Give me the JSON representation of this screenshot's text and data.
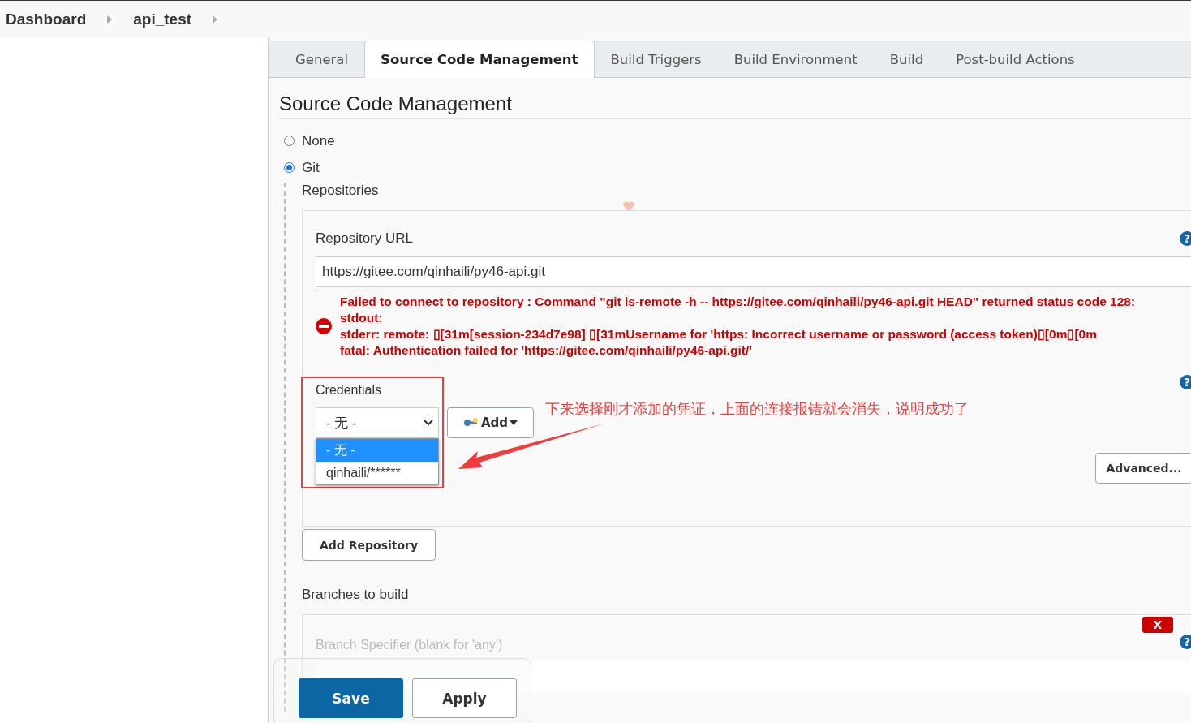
{
  "breadcrumb": [
    {
      "label": "Dashboard"
    },
    {
      "label": "api_test"
    }
  ],
  "tabs": [
    {
      "label": "General",
      "selected": false
    },
    {
      "label": "Source Code Management",
      "selected": true
    },
    {
      "label": "Build Triggers",
      "selected": false
    },
    {
      "label": "Build Environment",
      "selected": false
    },
    {
      "label": "Build",
      "selected": false
    },
    {
      "label": "Post-build Actions",
      "selected": false
    }
  ],
  "section_title": "Source Code Management",
  "scm_options": [
    {
      "label": "None",
      "selected": false
    },
    {
      "label": "Git",
      "selected": true
    }
  ],
  "repositories_label": "Repositories",
  "repository_url": {
    "label": "Repository URL",
    "help": "?",
    "value": "https://gitee.com/qinhaili/py46-api.git"
  },
  "error_lines": [
    "Failed to connect to repository : Command \"git ls-remote -h -- https://gitee.com/qinhaili/py46-api.git HEAD\" returned status code 128:",
    "stdout:",
    "stderr: remote: ▯[31m[session-234d7e98] ▯[31mUsername for 'https: Incorrect username or password (access token)▯[0m▯[0m",
    "fatal: Authentication failed for 'https://gitee.com/qinhaili/py46-api.git/'"
  ],
  "credentials": {
    "label": "Credentials",
    "help": "?",
    "value": "- 无 -",
    "options": [
      {
        "label": "- 无 -",
        "selected": true
      },
      {
        "label": "qinhaili/******",
        "selected": false
      }
    ],
    "add_button": "Add"
  },
  "annotation": "下来选择刚才添加的凭证，上面的连接报错就会消失，说明成功了",
  "advanced_button": "Advanced...",
  "add_repository_button": "Add Repository",
  "branches": {
    "label": "Branches to build",
    "delete_button": "X",
    "help": "?",
    "specifier_label": "Branch Specifier (blank for 'any')"
  },
  "buttons": [
    {
      "label": "Save",
      "kind": "primary"
    },
    {
      "label": "Apply",
      "kind": "secondary"
    }
  ]
}
